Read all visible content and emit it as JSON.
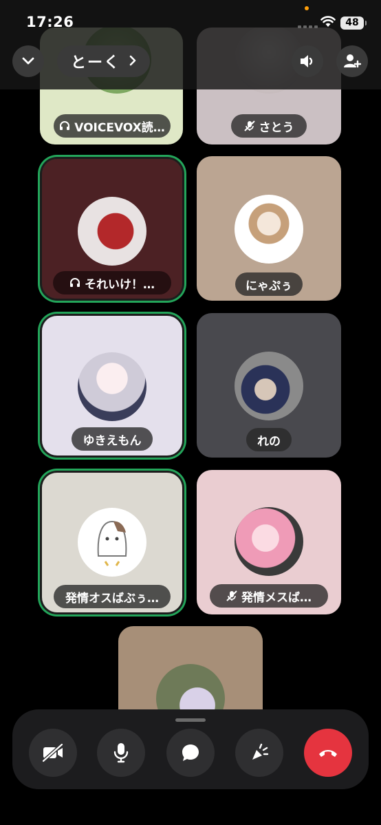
{
  "status_bar": {
    "time": "17:26",
    "battery": "48"
  },
  "header": {
    "channel_name": "とーく"
  },
  "participants": [
    {
      "name": "VOICEVOX読…",
      "status_icon": "headphones-icon"
    },
    {
      "name": "さとう",
      "status_icon": "mic-muted-icon"
    },
    {
      "name": "それいけ！…",
      "status_icon": "headphones-icon",
      "speaking": true
    },
    {
      "name": "にゃぷぅ"
    },
    {
      "name": "ゆきえもん",
      "speaking": true
    },
    {
      "name": "れの"
    },
    {
      "name": "発情オスばぶぅ…",
      "speaking": true
    },
    {
      "name": "発情メスば…",
      "status_icon": "mic-muted-icon"
    },
    {
      "name": ""
    }
  ],
  "colors": {
    "speaking_ring": "#23a55a",
    "end_call": "#e5343f",
    "tile_1": "#dfe8c6",
    "tile_2": "#cbc0c3",
    "tile_3": "#4c2124",
    "tile_4": "#bba592",
    "tile_5": "#e4e0ec",
    "tile_6": "#49494e",
    "tile_7": "#dcd9d1",
    "tile_8": "#eacdd1",
    "tile_9": "#a78f78"
  },
  "controls": [
    "camera-off-icon",
    "microphone-icon",
    "chat-bubble-icon",
    "soundboard-icon",
    "end-call-icon"
  ]
}
